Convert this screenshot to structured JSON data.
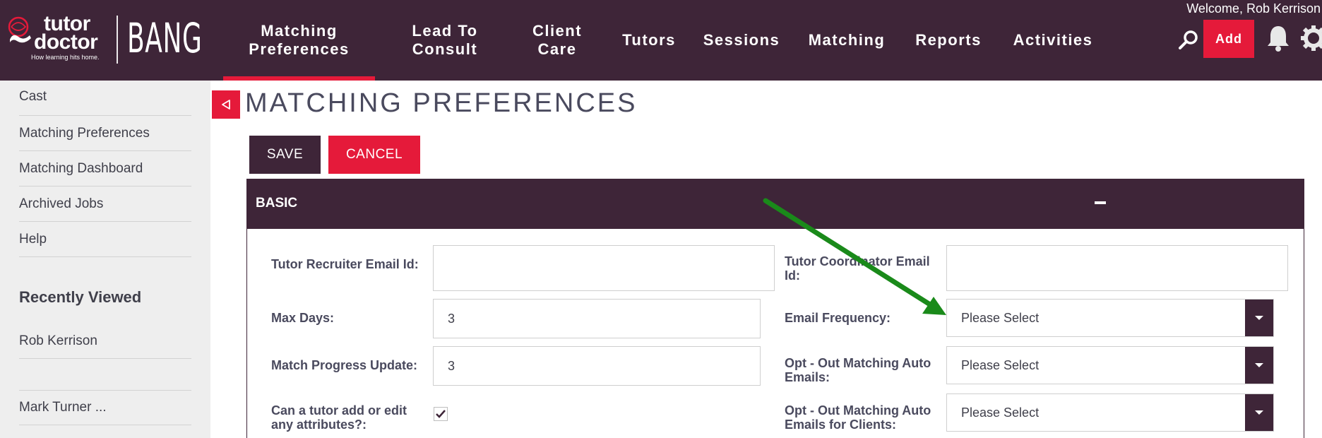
{
  "brand": {
    "logo_line1": "tutor",
    "logo_line2": "doctor",
    "tagline": "How learning hits home.",
    "product": "BANG"
  },
  "nav": {
    "items": [
      {
        "label": "Matching Preferences",
        "active": true
      },
      {
        "label": "Lead To Consult",
        "active": false
      },
      {
        "label": "Client Care",
        "active": false
      },
      {
        "label": "Tutors",
        "active": false
      },
      {
        "label": "Sessions",
        "active": false
      },
      {
        "label": "Matching",
        "active": false
      },
      {
        "label": "Reports",
        "active": false
      },
      {
        "label": "Activities",
        "active": false
      }
    ],
    "welcome": "Welcome,  Rob Kerrison",
    "add_label": "Add"
  },
  "sidebar": {
    "links": [
      "Cast",
      "Matching Preferences",
      "Matching Dashboard",
      "Archived Jobs",
      "Help"
    ],
    "recently_viewed_heading": "Recently Viewed",
    "recent": [
      "Rob Kerrison",
      "Mark Turner ..."
    ]
  },
  "page": {
    "title": "MATCHING PREFERENCES",
    "save_label": "SAVE",
    "cancel_label": "CANCEL"
  },
  "panel": {
    "title": "BASIC",
    "fields": {
      "tutor_recruiter_email": {
        "label": "Tutor Recruiter Email Id:",
        "value": ""
      },
      "tutor_coordinator_email": {
        "label": "Tutor Coordinator Email Id:",
        "value": ""
      },
      "max_days": {
        "label": "Max Days:",
        "value": "3"
      },
      "email_frequency": {
        "label": "Email Frequency:",
        "value": "Please Select"
      },
      "match_progress_update": {
        "label": "Match Progress Update:",
        "value": "3"
      },
      "opt_out_auto_emails": {
        "label": "Opt - Out Matching Auto Emails:",
        "value": "Please Select"
      },
      "tutor_edit_attributes": {
        "label": "Can a tutor add or edit any attributes?:",
        "checked": true
      },
      "opt_out_auto_emails_clients": {
        "label": "Opt - Out Matching Auto Emails for Clients:",
        "value": "Please Select"
      }
    }
  },
  "colors": {
    "brand_dark": "#3e2538",
    "accent_red": "#e51a3a",
    "annotation_arrow": "#1a8a1a"
  }
}
